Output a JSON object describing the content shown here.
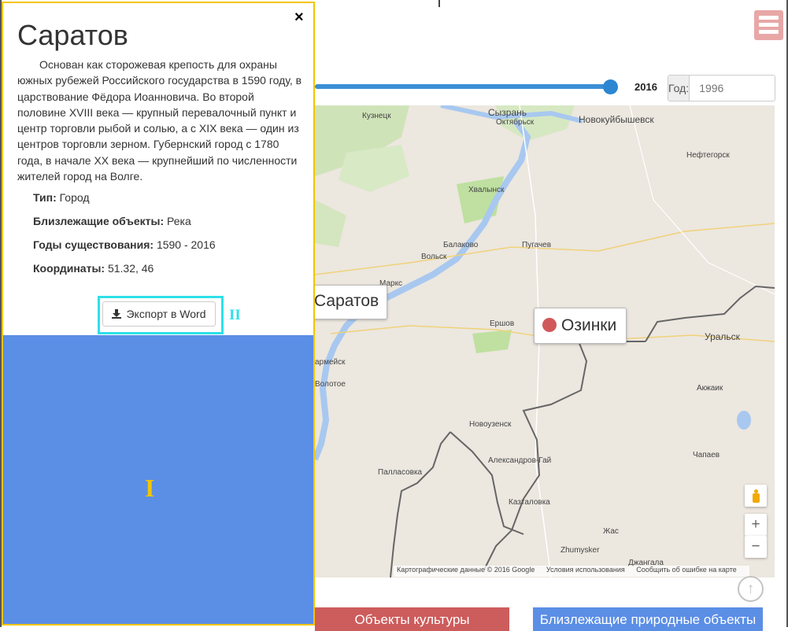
{
  "panel": {
    "close_icon": "×",
    "title": "Саратов",
    "description": "Основан как сторожевая крепость для охраны южных рубежей Российского государства в 1590 году, в царствование Фёдора Иоанновича. Во второй половине XVIII века — крупный перевалочный пункт и центр торговли рыбой и солью, а с XIX века — один из центров торговли зерном. Губернский город с 1780 года, в начале XX века — крупнейший по численности жителей город на Волге.",
    "type_label": "Тип:",
    "type_value": "Город",
    "nearby_label": "Близлежащие объекты:",
    "nearby_value": "Река",
    "years_label": "Годы существования:",
    "years_value": "1590 - 2016",
    "coords_label": "Координаты:",
    "coords_value": "51.32, 46",
    "export_label": "Экспорт в Word",
    "export_icon": "download-icon",
    "marker_ii": "II",
    "marker_i": "I"
  },
  "slider": {
    "max_label": "2016",
    "value_fraction": 1.0
  },
  "year_input": {
    "addon": "Год:",
    "placeholder": "1996"
  },
  "map": {
    "cities": {
      "kuznetsk": "Кузнецк",
      "syzran": "Сызрань",
      "oktyabrsk": "Октябрьск",
      "novokuybyshevsk": "Новокуйбышевск",
      "neftegorsk": "Нефтегорск",
      "khvalynsk": "Хвалынск",
      "balakovo": "Балаково",
      "volsk": "Вольск",
      "pugachev": "Пугачев",
      "marks": "Маркс",
      "ershov": "Ершов",
      "uralsk": "Уральск",
      "krasnoarmeysk": "армейск",
      "kamyshin": "Волотое",
      "novouzensk": "Новоузенск",
      "aksai": "Акжаик",
      "aleksandrov_gai": "Александров-Гай",
      "pallasovka": "Палласовка",
      "chapaev": "Чапаев",
      "kaztalovka": "Казталовка",
      "zhas": "Жас",
      "zhumysker": "Zhumysker",
      "dzhangala": "Джангала"
    },
    "label_saratov": "Саратов",
    "label_ozinki": "Озинки",
    "zoom_in": "+",
    "zoom_out": "−",
    "attribution": "Картографические данные © 2016 Google",
    "terms": "Условия использования",
    "report": "Сообщить об ошибке на карте"
  },
  "tabs": {
    "culture": "Объекты культуры",
    "nature": "Близлежащие природные объекты"
  },
  "colors": {
    "panel_border": "#f2c500",
    "export_highlight": "#2ee0e8",
    "blue_area": "#5b8ee5",
    "culture_tab": "#cd5c5c",
    "marker_dot": "#d1585a"
  }
}
